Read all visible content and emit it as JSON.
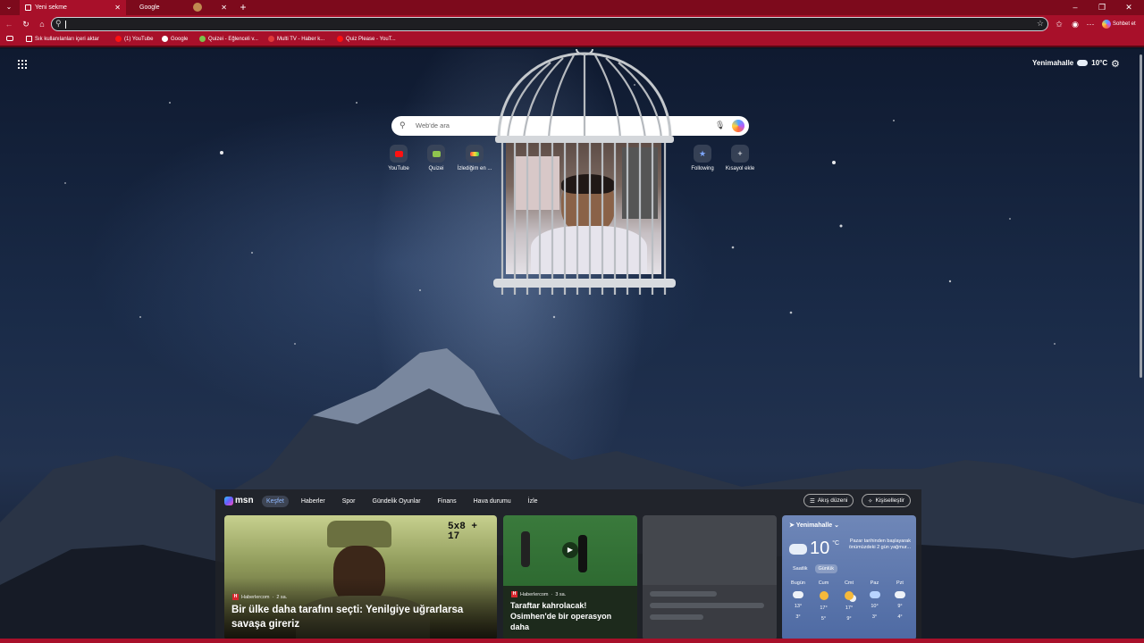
{
  "browser": {
    "tabs": [
      {
        "label": "Yeni sekme",
        "active": true
      },
      {
        "label": "Google",
        "active": false
      }
    ],
    "address": {
      "value": "",
      "placeholder": ""
    },
    "chat_button": "Sohbet et",
    "bookmarks": [
      {
        "label": "Sık kullanılanları içeri aktar"
      },
      {
        "label": "(1) YouTube"
      },
      {
        "label": "Google"
      },
      {
        "label": "Quizei - Eğlenceli v..."
      },
      {
        "label": "Multi TV - Haber k..."
      },
      {
        "label": "Quiz Please - YouT..."
      }
    ],
    "accent_color": "#a8102a"
  },
  "newtab": {
    "weather": {
      "location": "Yenimahalle",
      "temp": "10°C"
    },
    "search": {
      "placeholder": "Web'de ara"
    },
    "quicklinks": [
      {
        "label": "YouTube",
        "icon": "youtube-icon"
      },
      {
        "label": "Quizei",
        "icon": "quizei-icon"
      },
      {
        "label": "İzlediğim en ...",
        "icon": "site-icon"
      },
      {
        "label": "Following",
        "icon": "star-icon"
      },
      {
        "label": "Kısayol ekle",
        "icon": "plus-icon"
      }
    ]
  },
  "feed": {
    "nav": [
      "Keşfet",
      "Haberler",
      "Spor",
      "Gündelik Oyunlar",
      "Finans",
      "Hava durumu",
      "İzle"
    ],
    "nav_active": "Keşfet",
    "feed_layout_button": "Akış düzeni",
    "personalize_button": "Kişiselleştir",
    "cards": [
      {
        "source": "Haberlercom",
        "time": "2 sa.",
        "headline": "Bir ülke daha tarafını seçti: Yenilgiye uğrarlarsa savaşa gireriz",
        "image_text": "5x8 +\n17"
      },
      {
        "source": "Haberlercom",
        "time": "3 sa.",
        "headline": "Taraftar kahrolacak! Osimhen'de bir operasyon daha"
      }
    ],
    "weather": {
      "location": "Yenimahalle",
      "temp": "10",
      "unit": "°C",
      "note": "Pazar tarihinden başlayarak önümüzdeki 2 gün yağmur...",
      "tabs": [
        "Saatlik",
        "Günlük"
      ],
      "tab_active": "Günlük",
      "days": [
        {
          "day": "Bugün",
          "high": "13°",
          "low": "3°",
          "icon": "partly-cloudy-icon"
        },
        {
          "day": "Cum",
          "high": "17°",
          "low": "5°",
          "icon": "sunny-icon"
        },
        {
          "day": "Cmt",
          "high": "17°",
          "low": "9°",
          "icon": "partly-sunny-icon"
        },
        {
          "day": "Paz",
          "high": "10°",
          "low": "3°",
          "icon": "rain-icon"
        },
        {
          "day": "Pzt",
          "high": "9°",
          "low": "4°",
          "icon": "partly-cloudy-icon"
        }
      ]
    }
  }
}
